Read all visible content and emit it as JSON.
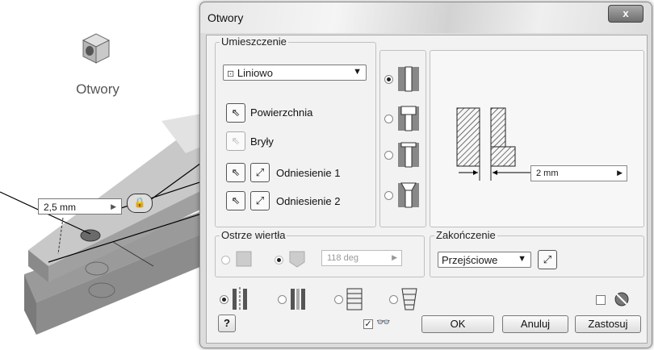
{
  "background": {
    "tool_label": "Otwory",
    "dimension_value": "2,5 mm"
  },
  "dialog": {
    "title": "Otwory",
    "close_label": "x",
    "placement": {
      "group_label": "Umieszczenie",
      "type_value": "Liniowo",
      "selectors": {
        "surface": "Powierzchnia",
        "solids": "Bryły",
        "reference1": "Odniesienie 1",
        "reference2": "Odniesienie 2"
      }
    },
    "hole_types": [
      "simple-hole-icon",
      "counterbore-icon",
      "spotface-icon",
      "countersink-icon"
    ],
    "preview": {
      "dimension": "2 mm"
    },
    "drill_point": {
      "group_label": "Ostrze wiertła",
      "angle_value": "118 deg"
    },
    "termination": {
      "group_label": "Zakończenie",
      "value": "Przejściowe"
    },
    "buttons": {
      "ok": "OK",
      "cancel": "Anuluj",
      "apply": "Zastosuj",
      "help": "?"
    }
  }
}
